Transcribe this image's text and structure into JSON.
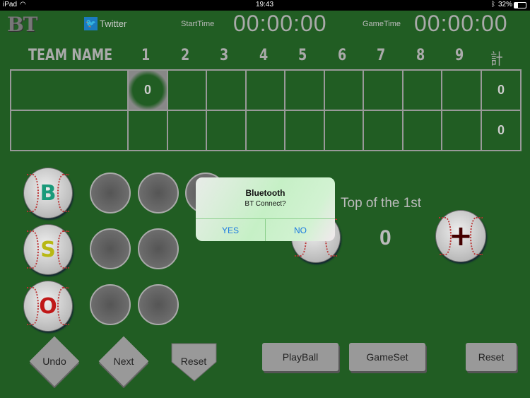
{
  "status_bar": {
    "device": "iPad",
    "time": "19:43",
    "battery": "32%"
  },
  "header": {
    "logo": "BT",
    "twitter": "Twitter",
    "start_label": "StartTime",
    "start_time": "00:00:00",
    "game_label": "GameTime",
    "game_time": "00:00:00"
  },
  "scoreboard": {
    "team_header": "TEAM NAME",
    "innings": [
      "1",
      "2",
      "3",
      "4",
      "5",
      "6",
      "7",
      "8",
      "9"
    ],
    "total_header": "計",
    "rows": [
      {
        "team": "",
        "scores": [
          "0",
          "",
          "",
          "",
          "",
          "",
          "",
          "",
          ""
        ],
        "total": "0"
      },
      {
        "team": "",
        "scores": [
          "",
          "",
          "",
          "",
          "",
          "",
          "",
          "",
          ""
        ],
        "total": "0"
      }
    ]
  },
  "counts": {
    "ball": "B",
    "strike": "S",
    "out": "O",
    "colors": {
      "ball": "#1a9a7a",
      "strike": "#b8b814",
      "out": "#c01818"
    }
  },
  "inning": {
    "label": "Top of the 1st",
    "score": "0",
    "minus": "−",
    "plus": "+"
  },
  "buttons": {
    "undo": "Undo",
    "next": "Next",
    "reset_plate": "Reset",
    "playball": "PlayBall",
    "gameset": "GameSet",
    "reset": "Reset"
  },
  "dialog": {
    "title": "Bluetooth",
    "message": "BT Connect?",
    "yes": "YES",
    "no": "NO"
  }
}
